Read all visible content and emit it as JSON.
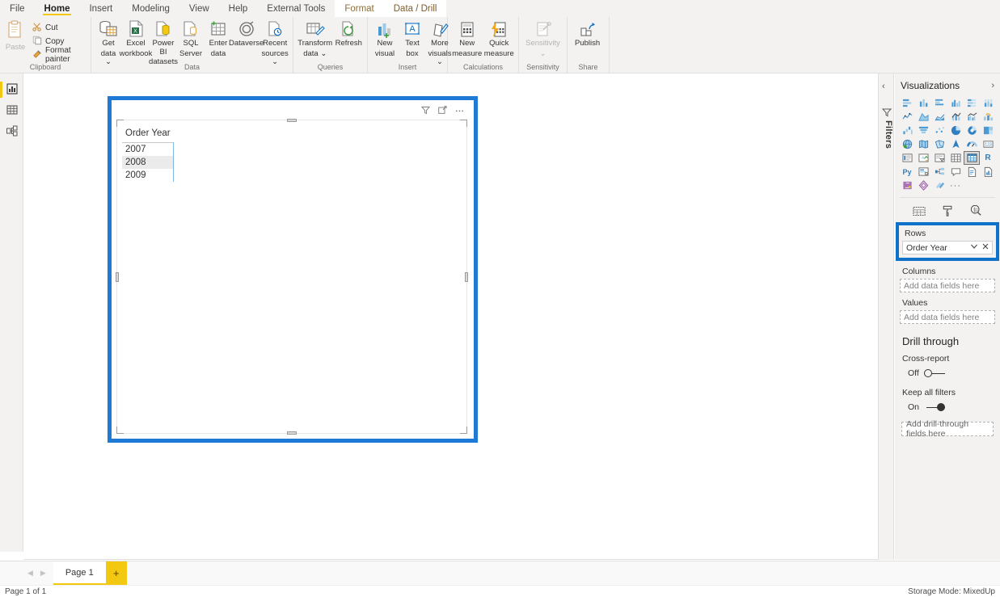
{
  "ribbon": {
    "tabs": [
      {
        "label": "File",
        "state": "normal"
      },
      {
        "label": "Home",
        "state": "active"
      },
      {
        "label": "Insert",
        "state": "normal"
      },
      {
        "label": "Modeling",
        "state": "normal"
      },
      {
        "label": "View",
        "state": "normal"
      },
      {
        "label": "Help",
        "state": "normal"
      },
      {
        "label": "External Tools",
        "state": "normal"
      },
      {
        "label": "Format",
        "state": "contextual"
      },
      {
        "label": "Data / Drill",
        "state": "contextual"
      }
    ],
    "groups": [
      {
        "name": "Clipboard",
        "label": "Clipboard",
        "paste": "Paste",
        "small_items": [
          {
            "label": "Cut",
            "icon": "scissors-icon"
          },
          {
            "label": "Copy",
            "icon": "copy-icon"
          },
          {
            "label": "Format painter",
            "icon": "format-painter-icon"
          }
        ]
      },
      {
        "name": "Data",
        "label": "Data",
        "items": [
          {
            "line1": "Get",
            "line2": "data ⌄",
            "icon": "get-data-icon"
          },
          {
            "line1": "Excel",
            "line2": "workbook",
            "icon": "excel-icon"
          },
          {
            "line1": "Power BI",
            "line2": "datasets",
            "icon": "powerbi-datasets-icon"
          },
          {
            "line1": "SQL",
            "line2": "Server",
            "icon": "sql-server-icon"
          },
          {
            "line1": "Enter",
            "line2": "data",
            "icon": "enter-data-icon"
          },
          {
            "line1": "Dataverse",
            "line2": "",
            "icon": "dataverse-icon"
          },
          {
            "line1": "Recent",
            "line2": "sources ⌄",
            "icon": "recent-sources-icon"
          }
        ]
      },
      {
        "name": "Queries",
        "label": "Queries",
        "items": [
          {
            "line1": "Transform",
            "line2": "data ⌄",
            "icon": "transform-data-icon"
          },
          {
            "line1": "Refresh",
            "line2": "",
            "icon": "refresh-icon"
          }
        ]
      },
      {
        "name": "Insert",
        "label": "Insert",
        "items": [
          {
            "line1": "New",
            "line2": "visual",
            "icon": "new-visual-icon"
          },
          {
            "line1": "Text",
            "line2": "box",
            "icon": "text-box-icon"
          },
          {
            "line1": "More",
            "line2": "visuals ⌄",
            "icon": "more-visuals-icon"
          }
        ]
      },
      {
        "name": "Calculations",
        "label": "Calculations",
        "items": [
          {
            "line1": "New",
            "line2": "measure",
            "icon": "new-measure-icon"
          },
          {
            "line1": "Quick",
            "line2": "measure",
            "icon": "quick-measure-icon"
          }
        ]
      },
      {
        "name": "Sensitivity",
        "label": "Sensitivity",
        "items": [
          {
            "line1": "Sensitivity",
            "line2": "⌄",
            "icon": "sensitivity-icon",
            "disabled": true
          }
        ]
      },
      {
        "name": "Share",
        "label": "Share",
        "items": [
          {
            "line1": "Publish",
            "line2": "",
            "icon": "publish-icon"
          }
        ]
      }
    ]
  },
  "leftnav": {
    "items": [
      {
        "name": "report-view",
        "icon": "report-view-icon",
        "active": true
      },
      {
        "name": "data-view",
        "icon": "data-view-icon",
        "active": false
      },
      {
        "name": "model-view",
        "icon": "model-view-icon",
        "active": false
      }
    ]
  },
  "visual": {
    "header_icons": [
      {
        "name": "filter-icon",
        "title": "Filters"
      },
      {
        "name": "focus-mode-icon",
        "title": "Focus mode"
      },
      {
        "name": "more-options-icon",
        "title": "More options"
      }
    ],
    "matrix": {
      "column_header": "Order Year",
      "rows": [
        {
          "value": "2007",
          "selected": false
        },
        {
          "value": "2008",
          "selected": true
        },
        {
          "value": "2009",
          "selected": false
        }
      ]
    }
  },
  "filters_rail": {
    "collapse_chevron": "‹",
    "icon": "filter-icon",
    "label": "Filters"
  },
  "visualizations": {
    "title": "Visualizations",
    "expand_chevron": "›",
    "icons": [
      "stacked-bar-chart-icon",
      "stacked-column-chart-icon",
      "clustered-bar-chart-icon",
      "clustered-column-chart-icon",
      "hundred-percent-stacked-bar-icon",
      "hundred-percent-stacked-column-icon",
      "line-chart-icon",
      "area-chart-icon",
      "stacked-area-chart-icon",
      "line-stacked-column-chart-icon",
      "line-clustered-column-chart-icon",
      "ribbon-chart-icon",
      "waterfall-chart-icon",
      "funnel-chart-icon",
      "scatter-chart-icon",
      "pie-chart-icon",
      "donut-chart-icon",
      "treemap-icon",
      "map-icon",
      "filled-map-icon",
      "shape-map-icon",
      "arcgis-map-icon",
      "gauge-icon",
      "card-icon",
      "multi-row-card-icon",
      "kpi-icon",
      "slicer-icon",
      "table-icon",
      "matrix-icon",
      "r-script-visual-icon",
      "python-visual-icon",
      "key-influencers-icon",
      "decomposition-tree-icon",
      "qna-icon",
      "smart-narrative-icon",
      "paginated-report-icon",
      "power-apps-icon",
      "power-automate-icon",
      "azure-ml-icon",
      "more-visuals-ellipsis-icon"
    ],
    "selected_icon": "matrix-icon",
    "pane_tabs": [
      {
        "name": "fields-tab",
        "icon": "fields-table-icon",
        "active": true
      },
      {
        "name": "format-tab",
        "icon": "paint-roller-icon",
        "active": false
      },
      {
        "name": "analytics-tab",
        "icon": "magnifier-analytics-icon",
        "active": false
      }
    ]
  },
  "field_wells": {
    "rows": {
      "label": "Rows",
      "field": "Order Year",
      "dropdown_icon": "chevron-down-icon",
      "remove_icon": "close-icon",
      "highlighted": true
    },
    "columns": {
      "label": "Columns",
      "placeholder": "Add data fields here"
    },
    "values": {
      "label": "Values",
      "placeholder": "Add data fields here"
    }
  },
  "drill_through": {
    "title": "Drill through",
    "cross_report": {
      "label": "Cross-report",
      "state_text": "Off",
      "on": false
    },
    "keep_all_filters": {
      "label": "Keep all filters",
      "state_text": "On",
      "on": true
    },
    "drop_placeholder": "Add drill-through fields here"
  },
  "pagebar": {
    "prev_icon": "chevron-left-icon",
    "next_icon": "chevron-right-icon",
    "tabs": [
      {
        "label": "Page 1",
        "active": true
      }
    ],
    "add_label": "+"
  },
  "statusbar": {
    "left": "Page 1 of 1",
    "right": "Storage Mode: MixedUp"
  },
  "colors": {
    "accent_yellow": "#f2c811",
    "selection_blue": "#1e7ad4",
    "well_highlight_blue": "#0f71c8",
    "ribbon_bg": "#f3f2f1"
  }
}
